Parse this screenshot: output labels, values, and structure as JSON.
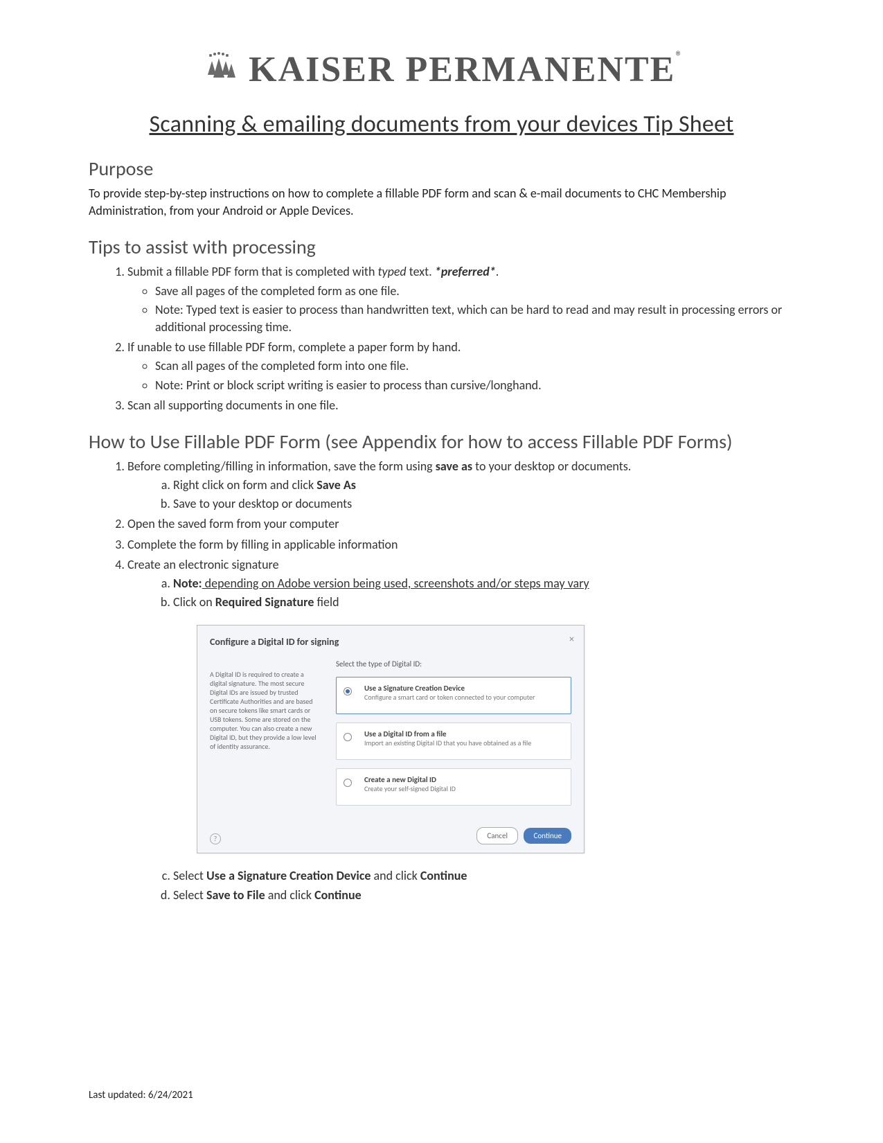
{
  "logo": {
    "text": "KAISER PERMANENTE",
    "registered": "®"
  },
  "doc_title": "Scanning & emailing documents from your devices Tip Sheet",
  "sections": {
    "purpose": {
      "heading": "Purpose",
      "body": "To provide step-by-step instructions on how to complete a fillable PDF form and scan & e-mail documents to CHC Membership Administration, from your Android or Apple Devices."
    },
    "tips": {
      "heading": "Tips to assist with processing",
      "item1_pre": "Submit a fillable PDF form that is completed with ",
      "item1_typed": "typed",
      "item1_mid": " text. ",
      "item1_pref": "*preferred*",
      "item1_end": ".",
      "item1_sub1": "Save all pages of the completed form as one file.",
      "item1_sub2": "Note: Typed text is easier to process than handwritten text, which can be hard to read and may result in processing errors or additional processing time.",
      "item2": "If unable to use fillable PDF form, complete a paper form by hand.",
      "item2_sub1": "Scan all pages of the completed form into one file.",
      "item2_sub2": "Note: Print or block script writing is easier to process than cursive/longhand.",
      "item3": "Scan all supporting documents in one file."
    },
    "howto": {
      "heading": "How to Use Fillable PDF Form (see Appendix for how to access Fillable PDF Forms)",
      "s1_pre": "Before completing/filling in information, save the form using ",
      "s1_bold": "save as",
      "s1_post": " to your desktop or documents.",
      "s1a_pre": "Right click on form and click ",
      "s1a_bold": "Save As",
      "s1b": "Save to your desktop or documents",
      "s2": "Open the saved form from your computer",
      "s3": "Complete the form by filling in applicable information",
      "s4": "Create an electronic signature",
      "s4a_label": "Note:",
      "s4a_body": " depending on Adobe version being used, screenshots and/or steps may vary",
      "s4b_pre": "Click on ",
      "s4b_bold": "Required Signature",
      "s4b_post": " field",
      "s4c_pre": "Select ",
      "s4c_bold": "Use a Signature Creation Device",
      "s4c_mid": " and click ",
      "s4c_bold2": "Continue",
      "s4d_pre": "Select ",
      "s4d_bold": "Save to File",
      "s4d_mid": " and click ",
      "s4d_bold2": "Continue"
    }
  },
  "dialog": {
    "title": "Configure a Digital ID for signing",
    "close": "×",
    "left_text": "A Digital ID is required to create a digital signature. The most secure Digital IDs are issued by trusted Certificate Authorities and are based on secure tokens like smart cards or USB tokens. Some are stored on the computer. You can also create a new Digital ID, but they provide a low level of identity assurance.",
    "right_head": "Select the type of Digital ID:",
    "opt1_title": "Use a Signature Creation Device",
    "opt1_sub": "Configure a smart card or token connected to your computer",
    "opt2_title": "Use a Digital ID from a file",
    "opt2_sub": "Import an existing Digital ID that you have obtained as a file",
    "opt3_title": "Create a new Digital ID",
    "opt3_sub": "Create your self-signed Digital ID",
    "cancel": "Cancel",
    "continue": "Continue"
  },
  "footer": "Last updated: 6/24/2021"
}
